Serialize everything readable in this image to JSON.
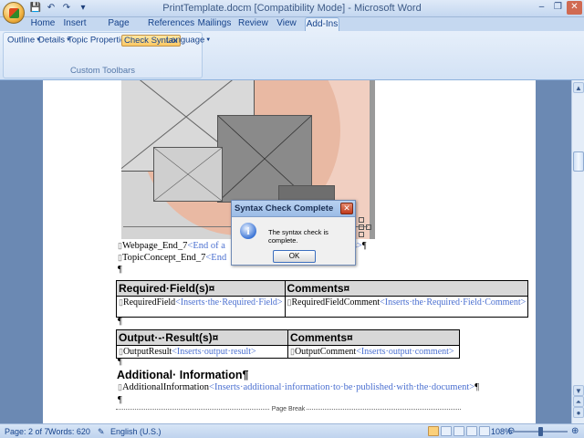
{
  "window": {
    "title": "PrintTemplate.docm [Compatibility Mode] - Microsoft Word"
  },
  "quick_access": [
    {
      "icon": "save-icon",
      "glyph": "💾"
    },
    {
      "icon": "undo-icon",
      "glyph": "↶"
    },
    {
      "icon": "redo-icon",
      "glyph": "↷"
    },
    {
      "icon": "customize-dropdown-icon",
      "glyph": "▾"
    }
  ],
  "window_controls": {
    "minimize": "–",
    "restore": "❐",
    "close": "✕"
  },
  "tabs": [
    "Home",
    "Insert",
    "Page Layout",
    "References",
    "Mailings",
    "Review",
    "View",
    "Add-Ins"
  ],
  "active_tab": "Add-Ins",
  "ribbon": {
    "buttons": [
      {
        "label": "Outline",
        "dropdown": true
      },
      {
        "label": "Details",
        "dropdown": true
      },
      {
        "label": "Topic Properties",
        "dropdown": true
      },
      {
        "label": "Check Syntax",
        "dropdown": false,
        "active": true
      },
      {
        "label": "Language",
        "dropdown": true
      }
    ],
    "group_label": "Custom Toolbars"
  },
  "document": {
    "line1_field": "Webpage_End_7",
    "line1_tag": "<End of a",
    "line1_tag_tail": "ges>",
    "line2_field": "TopicConcept_End_7",
    "line2_tag": "<End",
    "required_table": {
      "header_left": "Required·Field(s)¤",
      "header_right": "Comments¤",
      "cell_left_field": "RequiredField",
      "cell_left_tag": "<Inserts·the·Required·Field>",
      "cell_right_field": "RequiredFieldComment",
      "cell_right_tag": "<Inserts·the·Required·Field·Comment>"
    },
    "output_table": {
      "header_left": "Output·-·Result(s)¤",
      "header_right": "Comments¤",
      "cell_left_field": "OutputResult",
      "cell_left_tag": "<Inserts·output·result>",
      "cell_right_field": "OutputComment",
      "cell_right_tag": "<Inserts·output·comment>"
    },
    "heading": "Additional· Information¶",
    "info_field": "AdditionalInformation",
    "info_tag": "<Inserts·additional·information·to·be·published·with·the·document>",
    "page_break": "Page Break"
  },
  "dialog": {
    "title": "Syntax Check Complete",
    "message": "The syntax check is complete.",
    "ok_label": "OK",
    "icon": "info-icon"
  },
  "status": {
    "page": "Page: 2 of 7",
    "words": "Words: 620",
    "language": "English (U.S.)",
    "zoom": "108%",
    "zoom_value": 108
  },
  "colors": {
    "accent": "#15428b",
    "field_tag": "#4a6fd0",
    "ok_border": "#3c6fbf"
  }
}
